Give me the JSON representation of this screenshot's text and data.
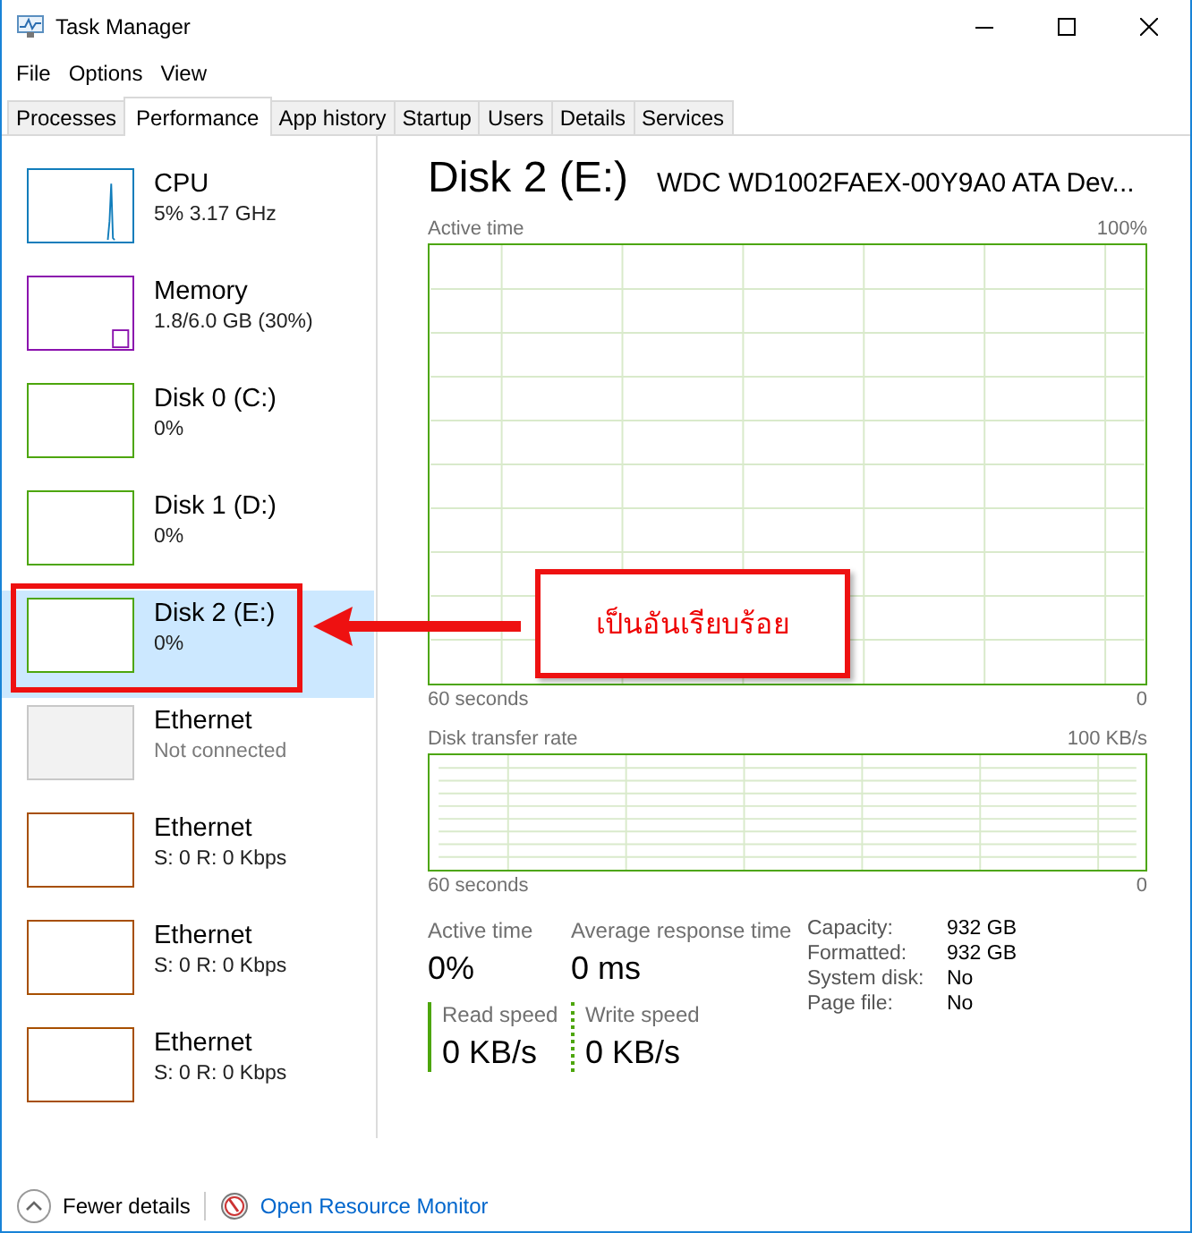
{
  "window": {
    "title": "Task Manager"
  },
  "menu": [
    "File",
    "Options",
    "View"
  ],
  "tabs": [
    {
      "label": "Processes",
      "selected": false
    },
    {
      "label": "Performance",
      "selected": true
    },
    {
      "label": "App history",
      "selected": false
    },
    {
      "label": "Startup",
      "selected": false
    },
    {
      "label": "Users",
      "selected": false
    },
    {
      "label": "Details",
      "selected": false
    },
    {
      "label": "Services",
      "selected": false
    }
  ],
  "sidebar": {
    "items": [
      {
        "kind": "cpu",
        "name": "CPU",
        "detail": "5%  3.17 GHz",
        "color": "#117dbb",
        "selected": false,
        "disabled": false
      },
      {
        "kind": "memory",
        "name": "Memory",
        "detail": "1.8/6.0 GB (30%)",
        "color": "#8b12ae",
        "selected": false,
        "disabled": false
      },
      {
        "kind": "disk",
        "name": "Disk 0 (C:)",
        "detail": "0%",
        "color": "#4da60c",
        "selected": false,
        "disabled": false
      },
      {
        "kind": "disk",
        "name": "Disk 1 (D:)",
        "detail": "0%",
        "color": "#4da60c",
        "selected": false,
        "disabled": false
      },
      {
        "kind": "disk",
        "name": "Disk 2 (E:)",
        "detail": "0%",
        "color": "#4da60c",
        "selected": true,
        "disabled": false
      },
      {
        "kind": "ethernet",
        "name": "Ethernet",
        "detail": "Not connected",
        "color": "#c8c8c8",
        "selected": false,
        "disabled": true
      },
      {
        "kind": "ethernet",
        "name": "Ethernet",
        "detail": "S: 0 R: 0 Kbps",
        "color": "#a74f01",
        "selected": false,
        "disabled": false
      },
      {
        "kind": "ethernet",
        "name": "Ethernet",
        "detail": "S: 0 R: 0 Kbps",
        "color": "#a74f01",
        "selected": false,
        "disabled": false
      },
      {
        "kind": "ethernet",
        "name": "Ethernet",
        "detail": "S: 0 R: 0 Kbps",
        "color": "#a74f01",
        "selected": false,
        "disabled": false
      }
    ]
  },
  "detail": {
    "title": "Disk 2 (E:)",
    "device": "WDC WD1002FAEX-00Y9A0 ATA Dev...",
    "graphs": [
      {
        "label": "Active time",
        "max": "100%",
        "time": "60 seconds",
        "min": "0",
        "kind": "tall"
      },
      {
        "label": "Disk transfer rate",
        "max": "100 KB/s",
        "time": "60 seconds",
        "min": "0",
        "kind": "short"
      }
    ],
    "stats": [
      {
        "label": "Active time",
        "value": "0%",
        "kind": "plain"
      },
      {
        "label": "Average response time",
        "value": "0 ms",
        "kind": "plain"
      },
      {
        "label": "Read speed",
        "value": "0 KB/s",
        "kind": "solid"
      },
      {
        "label": "Write speed",
        "value": "0 KB/s",
        "kind": "dotted"
      }
    ],
    "properties": [
      {
        "key": "Capacity:",
        "value": "932 GB"
      },
      {
        "key": "Formatted:",
        "value": "932 GB"
      },
      {
        "key": "System disk:",
        "value": "No"
      },
      {
        "key": "Page file:",
        "value": "No"
      }
    ]
  },
  "footer": {
    "toggle": "Fewer details",
    "link": "Open Resource Monitor"
  },
  "annotation": {
    "text": "เป็นอันเรียบร้อย"
  }
}
